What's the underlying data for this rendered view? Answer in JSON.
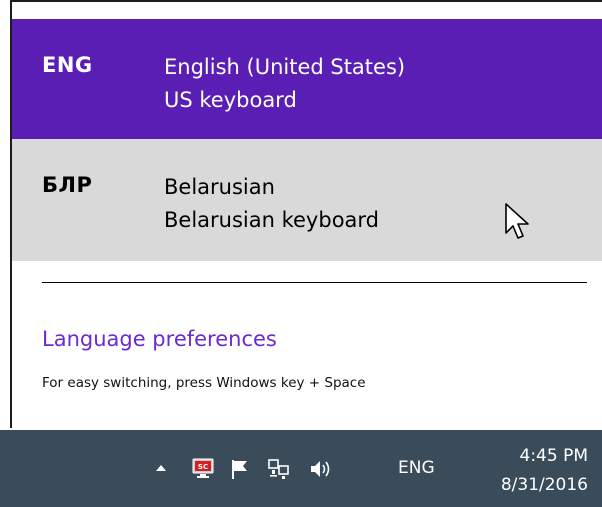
{
  "flyout": {
    "languages": [
      {
        "code": "ENG",
        "name": "English (United States)",
        "keyboard": "US keyboard",
        "state": "selected"
      },
      {
        "code": "БЛР",
        "name": "Belarusian",
        "keyboard": "Belarusian keyboard",
        "state": "hovered"
      }
    ],
    "preferences_link": "Language preferences",
    "hint": "For easy switching, press Windows key + Space"
  },
  "taskbar": {
    "tray_icons": [
      "chevron-up-icon",
      "sc-app-icon",
      "action-center-flag-icon",
      "network-icon",
      "volume-icon"
    ],
    "sc_icon_text": "SC",
    "input_language": "ENG",
    "clock": {
      "time": "4:45 PM",
      "date": "8/31/2016"
    }
  },
  "colors": {
    "selected_bg": "#5a1eb5",
    "hover_bg": "#d9d9d9",
    "link": "#6a2bd1",
    "taskbar_bg": "#3a4c5a"
  }
}
